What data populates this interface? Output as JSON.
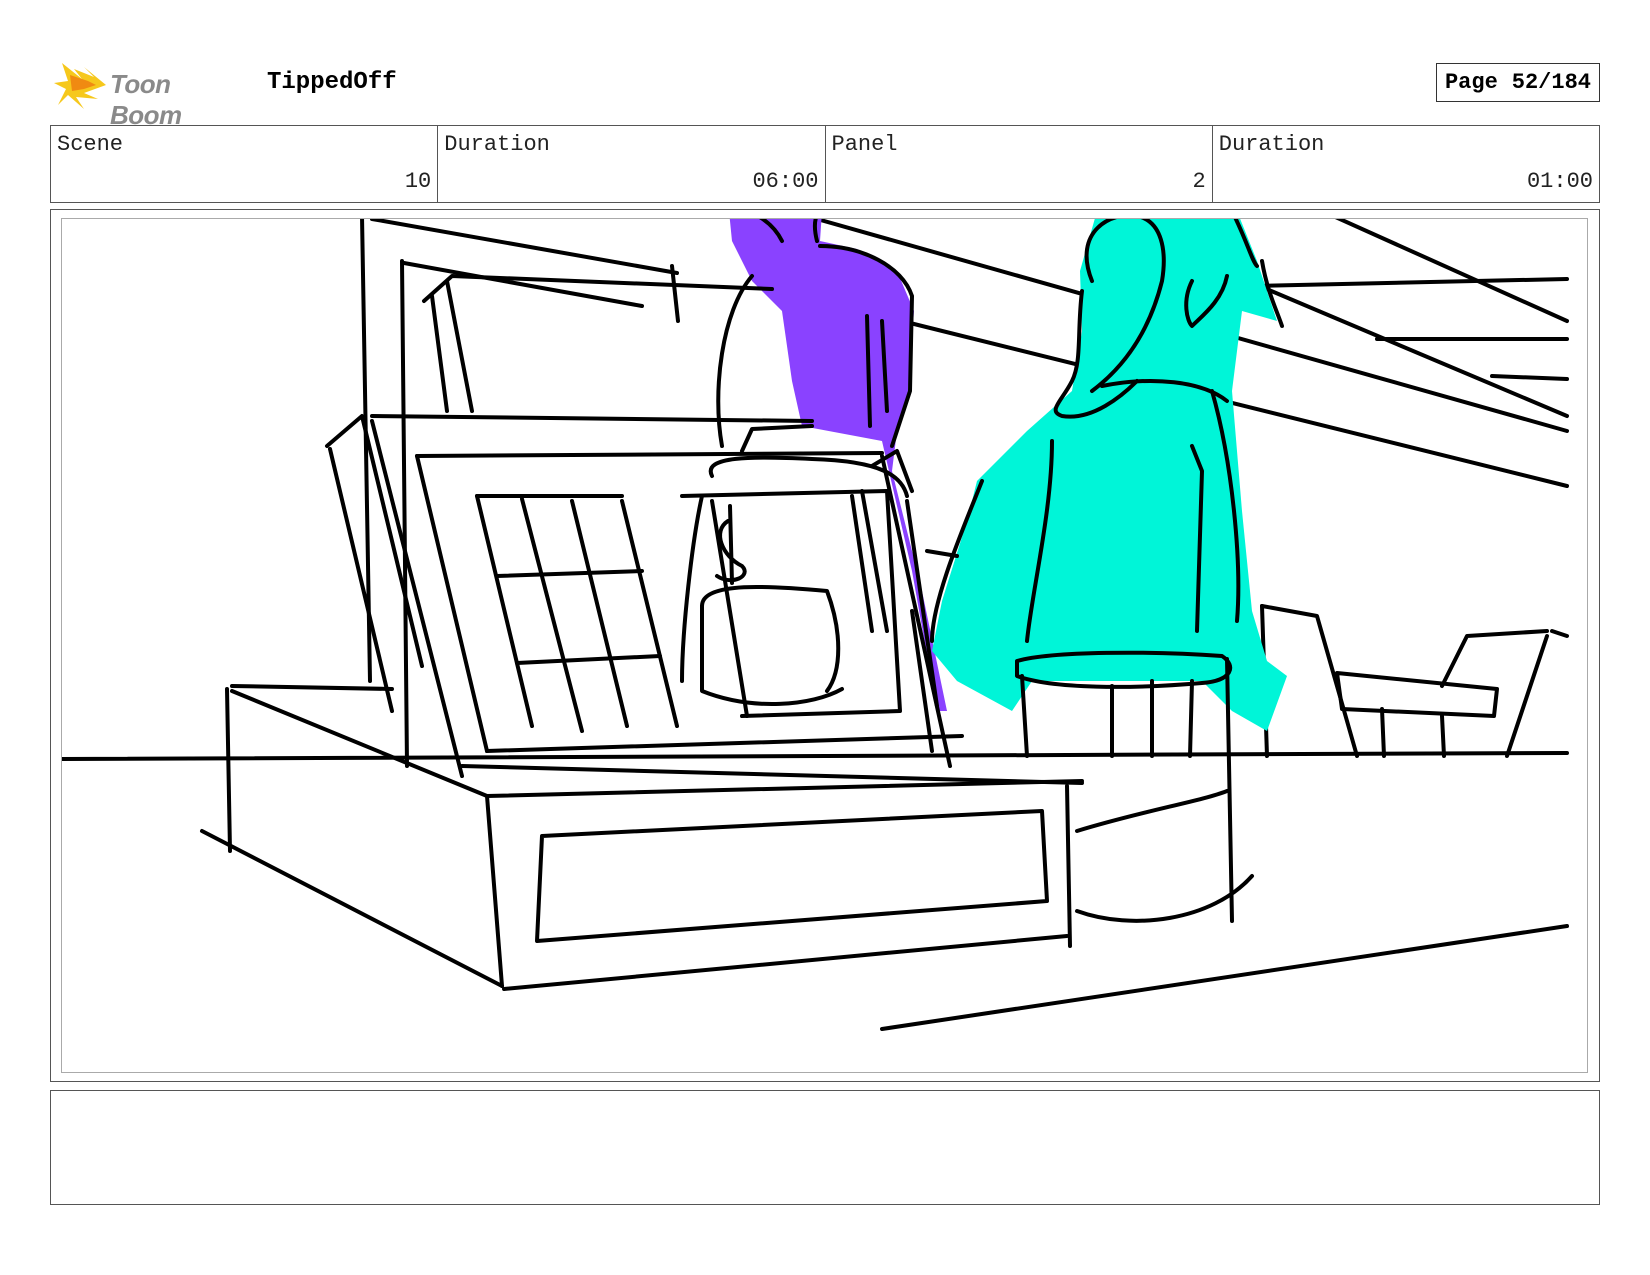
{
  "header": {
    "logo_text": "Toon Boom",
    "project_title": "TippedOff",
    "page_label": "Page",
    "page_number": "52/184"
  },
  "info": {
    "scene_label": "Scene",
    "scene_value": "10",
    "scene_duration_label": "Duration",
    "scene_duration_value": "06:00",
    "panel_label": "Panel",
    "panel_value": "2",
    "panel_duration_label": "Duration",
    "panel_duration_value": "01:00"
  },
  "panel": {
    "colors": {
      "purple_character": "#8a42ff",
      "cyan_character": "#00f5d8",
      "ink": "#000000"
    }
  },
  "notes": {
    "text": ""
  }
}
